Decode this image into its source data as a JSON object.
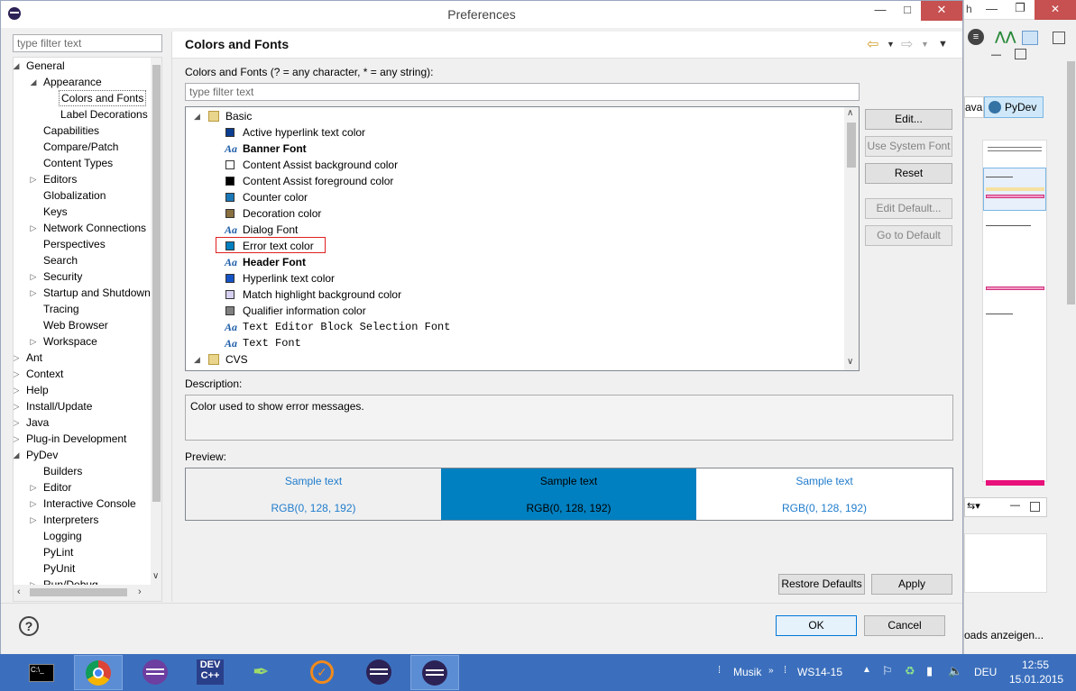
{
  "window": {
    "title": "Preferences",
    "minimize": "—",
    "maximize": "□",
    "close": "✕"
  },
  "left": {
    "filter_placeholder": "type filter text",
    "tree": [
      {
        "label": "General",
        "level": 0,
        "arrow": "open"
      },
      {
        "label": "Appearance",
        "level": 1,
        "arrow": "open"
      },
      {
        "label": "Colors and Fonts",
        "level": 2,
        "arrow": "none",
        "selected": true
      },
      {
        "label": "Label Decorations",
        "level": 2,
        "arrow": "none"
      },
      {
        "label": "Capabilities",
        "level": 1,
        "arrow": "none"
      },
      {
        "label": "Compare/Patch",
        "level": 1,
        "arrow": "none"
      },
      {
        "label": "Content Types",
        "level": 1,
        "arrow": "none"
      },
      {
        "label": "Editors",
        "level": 1,
        "arrow": "closed"
      },
      {
        "label": "Globalization",
        "level": 1,
        "arrow": "none"
      },
      {
        "label": "Keys",
        "level": 1,
        "arrow": "none"
      },
      {
        "label": "Network Connections",
        "level": 1,
        "arrow": "closed"
      },
      {
        "label": "Perspectives",
        "level": 1,
        "arrow": "none"
      },
      {
        "label": "Search",
        "level": 1,
        "arrow": "none"
      },
      {
        "label": "Security",
        "level": 1,
        "arrow": "closed"
      },
      {
        "label": "Startup and Shutdown",
        "level": 1,
        "arrow": "closed"
      },
      {
        "label": "Tracing",
        "level": 1,
        "arrow": "none"
      },
      {
        "label": "Web Browser",
        "level": 1,
        "arrow": "none"
      },
      {
        "label": "Workspace",
        "level": 1,
        "arrow": "closed"
      },
      {
        "label": "Ant",
        "level": 0,
        "arrow": "closed"
      },
      {
        "label": "Context",
        "level": 0,
        "arrow": "closed"
      },
      {
        "label": "Help",
        "level": 0,
        "arrow": "closed"
      },
      {
        "label": "Install/Update",
        "level": 0,
        "arrow": "closed"
      },
      {
        "label": "Java",
        "level": 0,
        "arrow": "closed"
      },
      {
        "label": "Plug-in Development",
        "level": 0,
        "arrow": "closed"
      },
      {
        "label": "PyDev",
        "level": 0,
        "arrow": "open"
      },
      {
        "label": "Builders",
        "level": 1,
        "arrow": "none"
      },
      {
        "label": "Editor",
        "level": 1,
        "arrow": "closed"
      },
      {
        "label": "Interactive Console",
        "level": 1,
        "arrow": "closed"
      },
      {
        "label": "Interpreters",
        "level": 1,
        "arrow": "closed"
      },
      {
        "label": "Logging",
        "level": 1,
        "arrow": "none"
      },
      {
        "label": "PyLint",
        "level": 1,
        "arrow": "none"
      },
      {
        "label": "PyUnit",
        "level": 1,
        "arrow": "none"
      },
      {
        "label": "Run/Debug",
        "level": 1,
        "arrow": "closed"
      }
    ]
  },
  "page": {
    "title": "Colors and Fonts",
    "hint": "Colors and Fonts (? = any character, * = any string):",
    "filter_placeholder": "type filter text",
    "categories": [
      {
        "label": "Basic"
      },
      {
        "label": "CVS"
      }
    ],
    "items": [
      {
        "label": "Active hyperlink text color",
        "kind": "color",
        "color": "#0b3d91",
        "style": "normal"
      },
      {
        "label": "Banner Font",
        "kind": "font",
        "style": "bold"
      },
      {
        "label": "Content Assist background color",
        "kind": "color",
        "color": "#ffffff",
        "style": "normal"
      },
      {
        "label": "Content Assist foreground color",
        "kind": "color",
        "color": "#000000",
        "style": "normal"
      },
      {
        "label": "Counter color",
        "kind": "color",
        "color": "#1b78b8",
        "style": "normal"
      },
      {
        "label": "Decoration color",
        "kind": "color",
        "color": "#8a7040",
        "style": "normal"
      },
      {
        "label": "Dialog Font",
        "kind": "font",
        "style": "normal"
      },
      {
        "label": "Error text color",
        "kind": "color",
        "color": "#0080c0",
        "style": "normal",
        "highlight": true
      },
      {
        "label": "Header Font",
        "kind": "font",
        "style": "bold"
      },
      {
        "label": "Hyperlink text color",
        "kind": "color",
        "color": "#1453c6",
        "style": "normal"
      },
      {
        "label": "Match highlight background color",
        "kind": "color",
        "color": "#d8d0f0",
        "style": "normal"
      },
      {
        "label": "Qualifier information color",
        "kind": "color",
        "color": "#808080",
        "style": "normal"
      },
      {
        "label": "Text Editor Block Selection Font",
        "kind": "font",
        "style": "mono"
      },
      {
        "label": "Text Font",
        "kind": "font",
        "style": "mono"
      }
    ],
    "buttons": {
      "edit": "Edit...",
      "use_system_font": "Use System Font",
      "reset": "Reset",
      "edit_default": "Edit Default...",
      "go_to_default": "Go to Default"
    },
    "description_label": "Description:",
    "description": "Color used to show error messages.",
    "preview_label": "Preview:",
    "preview": [
      {
        "sample": "Sample text",
        "rgb": "RGB(0, 128, 192)",
        "bg": "#f0f0f0",
        "fg": "#1f7ccc"
      },
      {
        "sample": "Sample text",
        "rgb": "RGB(0, 128, 192)",
        "bg": "#0080c0",
        "fg": "#000000"
      },
      {
        "sample": "Sample text",
        "rgb": "RGB(0, 128, 192)",
        "bg": "#ffffff",
        "fg": "#1f7ccc"
      }
    ],
    "restore_defaults": "Restore Defaults",
    "apply": "Apply"
  },
  "footer": {
    "help": "?",
    "ok": "OK",
    "cancel": "Cancel"
  },
  "background_window": {
    "perspective_java": "ava",
    "perspective_pydev": "PyDev",
    "status_text": "oads anzeigen..."
  },
  "taskbar": {
    "musik": "Musik",
    "ws": "WS14-15",
    "lang": "DEU",
    "time": "12:55",
    "date": "15.01.2015"
  },
  "colors": {
    "accent": "#0080c0",
    "taskbar": "#3b6fbd",
    "close": "#c75050"
  }
}
